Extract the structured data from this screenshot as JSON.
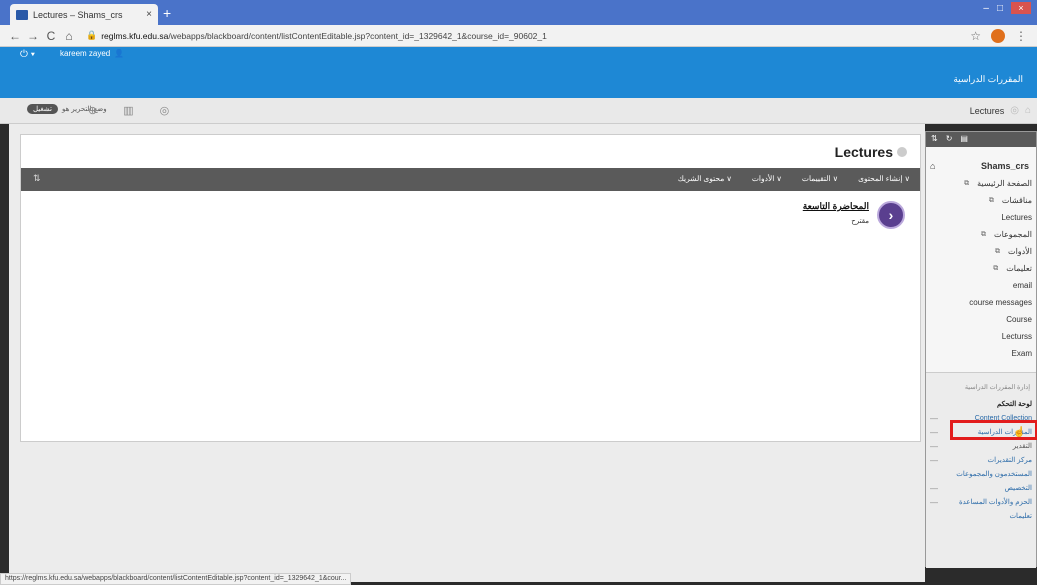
{
  "browser": {
    "tab_title": "Lectures – Shams_crs",
    "tab_close": "×",
    "new_tab": "+",
    "url_host": "reglms.kfu.edu.sa",
    "url_path": "/webapps/blackboard/content/listContentEditable.jsp?content_id=_1329642_1&course_id=_90602_1",
    "status_url": "https://reglms.kfu.edu.sa/webapps/blackboard/content/listContentEditable.jsp?content_id=_1329642_1&cour..."
  },
  "header": {
    "username": "kareem zayed",
    "courses_tab": "المقررات الدراسية"
  },
  "breadcrumb": {
    "current": "Lectures",
    "edit_mode_label": "وضع التحرير هو",
    "edit_mode_toggle": "تشغيل"
  },
  "page": {
    "title": "Lectures",
    "action_menus": [
      "إنشاء المحتوى ∨",
      "التقييمات ∨",
      "الأدوات ∨",
      "محتوى الشريك ∨"
    ],
    "sort_label": "⇅",
    "items": [
      {
        "title": "المحاضرة التاسعة",
        "subtitle": "مقترح"
      }
    ]
  },
  "sidebar": {
    "toolbar": [
      "⇅",
      "↻",
      "▤"
    ],
    "course_name": "Shams_crs",
    "menu": [
      {
        "label": "الصفحة الرئيسية",
        "ext": "⧉"
      },
      {
        "label": "مناقشات",
        "ext": "⧉"
      },
      {
        "label": "Lectures",
        "ext": ""
      },
      {
        "label": "المجموعات",
        "ext": "⧉"
      },
      {
        "label": "الأدوات",
        "ext": "⧉"
      },
      {
        "label": "تعليمات",
        "ext": "⧉"
      },
      {
        "label": "email",
        "ext": ""
      },
      {
        "label": "course messages",
        "ext": ""
      },
      {
        "label": "Course",
        "ext": ""
      },
      {
        "label": "Lecturss",
        "ext": ""
      },
      {
        "label": "Exam",
        "ext": ""
      }
    ],
    "management": {
      "heading": "إدارة المقررات الدراسية",
      "items": [
        {
          "label": "لوحة التحكم",
          "dash": "",
          "style": "dark"
        },
        {
          "label": "Content Collection",
          "dash": "—",
          "style": ""
        },
        {
          "label": "المقررات الدراسية",
          "dash": "—",
          "style": ""
        },
        {
          "label": "التقدير",
          "dash": "—",
          "style": "grey"
        },
        {
          "label": "مركز التقديرات",
          "dash": "—",
          "style": ""
        },
        {
          "label": "المستخدمون والمجموعات",
          "dash": "",
          "style": ""
        },
        {
          "label": "التخصيص",
          "dash": "—",
          "style": ""
        },
        {
          "label": "الحزم والأدوات المساعدة",
          "dash": "—",
          "style": ""
        },
        {
          "label": "تعليمات",
          "dash": "",
          "style": ""
        }
      ]
    }
  }
}
